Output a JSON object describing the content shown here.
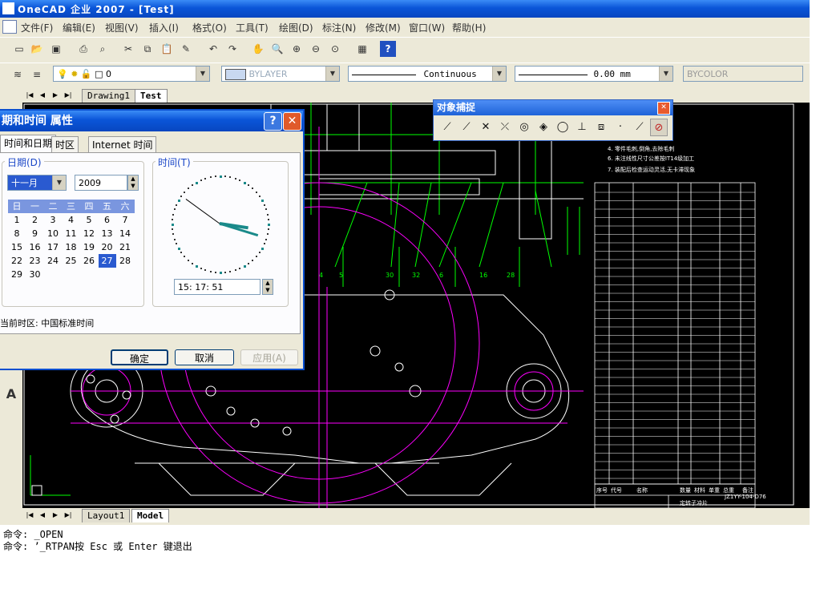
{
  "window": {
    "title": "OneCAD  企业  2007 - [Test]",
    "app_icon": "OneCAD"
  },
  "menubar": {
    "items": [
      "文件(F)",
      "编辑(E)",
      "视图(V)",
      "插入(I)",
      "格式(O)",
      "工具(T)",
      "绘图(D)",
      "标注(N)",
      "修改(M)",
      "窗口(W)",
      "帮助(H)"
    ]
  },
  "standard_toolbar": {
    "icons": [
      "new-icon",
      "open-icon",
      "save-icon",
      "print-icon",
      "print-preview-icon",
      "cut-icon",
      "copy-icon",
      "paste-icon",
      "match-properties-icon",
      "undo-icon",
      "redo-icon",
      "pan-icon",
      "zoom-realtime-icon",
      "zoom-window-icon",
      "zoom-previous-icon",
      "zoom-extents-icon",
      "properties-icon",
      "help-icon"
    ]
  },
  "properties_toolbar": {
    "layer_value": "0",
    "color_value": "BYLAYER",
    "linetype_value": "Continuous",
    "lineweight_value": "0.00 mm",
    "plotstyle_value": "BYCOLOR"
  },
  "doc_tabs": [
    "Drawing1",
    "Test"
  ],
  "layout_tabs": [
    "Layout1",
    "Model"
  ],
  "command_line": {
    "lines": [
      "命令: _OPEN",
      "命令: ’_RTPAN按 Esc 或 Enter 键退出"
    ]
  },
  "osnap_toolbar": {
    "title": "对象捕捉",
    "icons": [
      "endpoint-snap-icon",
      "midpoint-snap-icon",
      "intersection-snap-icon",
      "apparent-intersection-icon",
      "center-snap-icon",
      "quadrant-snap-icon",
      "tangent-snap-icon",
      "perpendicular-snap-icon",
      "insert-snap-icon",
      "node-snap-icon",
      "nearest-snap-icon",
      "snap-none-icon"
    ]
  },
  "datetime_dialog": {
    "title": "期和时间 属性",
    "tabs": [
      "时间和日期",
      "时区",
      "Internet 时间"
    ],
    "date_group_label": "日期(D)",
    "time_group_label": "时间(T)",
    "month": "十一月",
    "year": "2009",
    "weekdays": [
      "日",
      "一",
      "二",
      "三",
      "四",
      "五",
      "六"
    ],
    "calendar_rows": [
      [
        "",
        "",
        "",
        "",
        "",
        "",
        ""
      ],
      [
        "1",
        "2",
        "3",
        "4",
        "5",
        "6",
        "7"
      ],
      [
        "8",
        "9",
        "10",
        "11",
        "12",
        "13",
        "14"
      ],
      [
        "15",
        "16",
        "17",
        "18",
        "19",
        "20",
        "21"
      ],
      [
        "22",
        "23",
        "24",
        "25",
        "26",
        "27",
        "28"
      ],
      [
        "29",
        "30",
        "",
        "",
        "",
        "",
        ""
      ]
    ],
    "selected_day": "27",
    "time_value": "15: 17: 51",
    "timezone_text": "当前时区: 中国标准时间",
    "ok_label": "确定",
    "cancel_label": "取消",
    "apply_label": "应用(A)"
  },
  "drawing": {
    "notes": [
      "4. 零件毛刺,倒角,去除毛刺",
      "6. 未注线性尺寸公差按IT14级加工",
      "7. 装配后检查运动灵活,无卡滞现象"
    ],
    "callouts": [
      "4",
      "5",
      "30",
      "32",
      "6",
      "16",
      "28"
    ],
    "title_block": "定转子冲片",
    "drawing_no": "JZ1YY-104-D76",
    "bom_header": [
      "序号",
      "代号",
      "名称",
      "数量",
      "材料",
      "单重",
      "总重",
      "备注"
    ]
  },
  "colors": {
    "canvas": "#000000",
    "chrome": "#ece9d8",
    "titlebar": "#0a55d8",
    "cad_green": "#00ff00",
    "cad_magenta": "#ff00ff",
    "cad_white": "#ffffff"
  }
}
